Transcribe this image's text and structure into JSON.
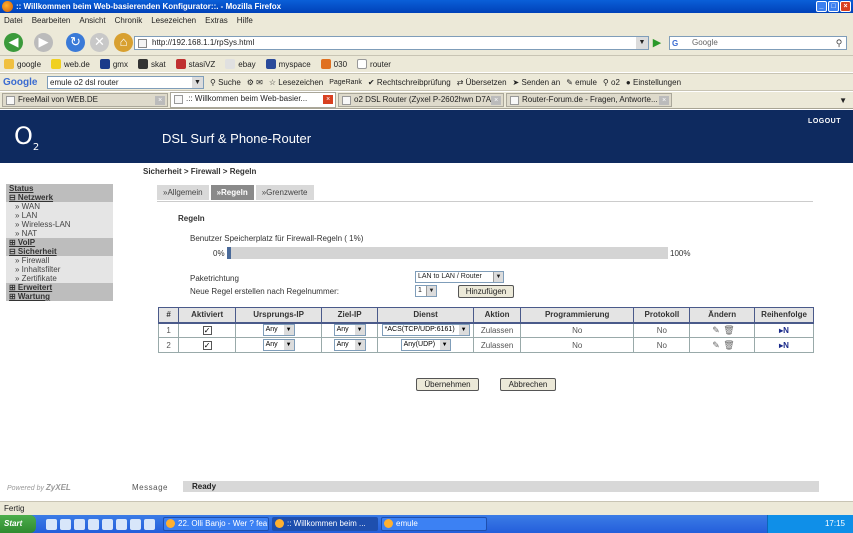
{
  "window": {
    "title": ":: Willkommen beim Web-basierenden Konfigurator::. - Mozilla Firefox"
  },
  "menu": [
    "Datei",
    "Bearbeiten",
    "Ansicht",
    "Chronik",
    "Lesezeichen",
    "Extras",
    "Hilfe"
  ],
  "nav": {
    "url": "http://192.168.1.1/rpSys.html",
    "search_placeholder": "Google"
  },
  "bookmarks": [
    "google",
    "web.de",
    "gmx",
    "skat",
    "stasiVZ",
    "ebay",
    "myspace",
    "030",
    "router"
  ],
  "googlebar": {
    "logo": "Google",
    "query": "emule o2 dsl router",
    "items": [
      "Suche",
      "Lesezeichen",
      "PageRank",
      "Rechtschreibprüfung",
      "Übersetzen",
      "Senden an",
      "emule",
      "o2",
      "Einstellungen"
    ]
  },
  "tabs": [
    {
      "label": "FreeMail von WEB.DE"
    },
    {
      "label": ".:: Willkommen beim Web-basier..."
    },
    {
      "label": "o2 DSL Router (Zyxel P-2602hwn D7A..."
    },
    {
      "label": "Router-Forum.de - Fragen, Antworte..."
    }
  ],
  "header": {
    "logo": "O",
    "logo_sub": "2",
    "title": "DSL Surf & Phone-Router",
    "logout": "LOGOUT"
  },
  "breadcrumb": "Sicherheit > Firewall > Regeln",
  "sidebar": [
    {
      "label": "Status",
      "type": "sec"
    },
    {
      "label": "⊟ Netzwerk",
      "type": "sec"
    },
    {
      "label": "» WAN",
      "type": "sub"
    },
    {
      "label": "» LAN",
      "type": "sub"
    },
    {
      "label": "» Wireless-LAN",
      "type": "sub"
    },
    {
      "label": "» NAT",
      "type": "sub"
    },
    {
      "label": "⊞ VoIP",
      "type": "sec"
    },
    {
      "label": "⊟ Sicherheit",
      "type": "sec"
    },
    {
      "label": "» Firewall",
      "type": "sub"
    },
    {
      "label": "» Inhaltsfilter",
      "type": "sub"
    },
    {
      "label": "» Zertifikate",
      "type": "sub"
    },
    {
      "label": "⊞ Erweitert",
      "type": "sec"
    },
    {
      "label": "⊞ Wartung",
      "type": "sec"
    }
  ],
  "page_tabs": [
    {
      "label": "»Allgemein"
    },
    {
      "label": "»Regeln"
    },
    {
      "label": "»Grenzwerte"
    }
  ],
  "section_title": "Regeln",
  "storage": {
    "label": "Benutzer Speicherplatz für Firewall-Regeln ( 1%)",
    "min_label": "0%",
    "max_label": "100%",
    "used_fraction": 0.01
  },
  "direction": {
    "label": "Paketrichtung",
    "value": "LAN to LAN / Router"
  },
  "new_rule": {
    "label": "Neue Regel erstellen nach Regelnummer:",
    "value": "1",
    "button": "Hinzufügen"
  },
  "table": {
    "headers": [
      "#",
      "Aktiviert",
      "Ursprungs-IP",
      "Ziel-IP",
      "Dienst",
      "Aktion",
      "Programmierung",
      "Protokoll",
      "Ändern",
      "Reihenfolge"
    ],
    "rows": [
      {
        "num": "1",
        "checked": "✓",
        "src": "Any",
        "dst": "Any",
        "service": "*ACS(TCP/UDP:6161)",
        "action": "Zulassen",
        "schedule": "No",
        "log": "No"
      },
      {
        "num": "2",
        "checked": "✓",
        "src": "Any",
        "dst": "Any",
        "service": "Any(UDP)",
        "action": "Zulassen",
        "schedule": "No",
        "log": "No"
      }
    ]
  },
  "buttons": {
    "apply": "Übernehmen",
    "cancel": "Abbrechen"
  },
  "footer": {
    "brand": "Powered by",
    "brand_name": "ZyXEL",
    "message_label": "Message",
    "message": "Ready"
  },
  "statusbar": "Fertig",
  "taskbar": {
    "start": "Start",
    "items": [
      "22. Olli Banjo - Wer ? fea...",
      ":: Willkommen beim ...",
      "emule"
    ],
    "clock": "17:15"
  }
}
